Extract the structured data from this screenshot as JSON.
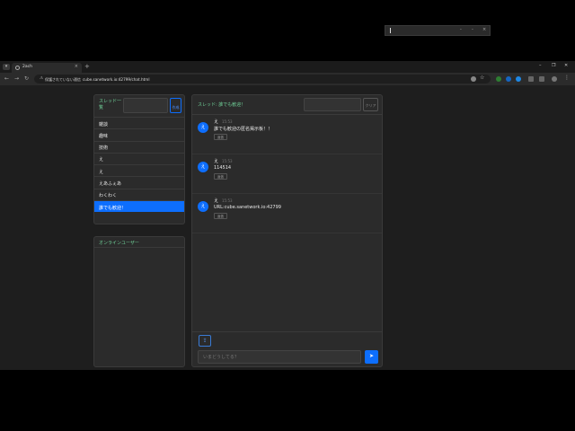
{
  "browser": {
    "tab_title": "2ach",
    "tab_close": "×",
    "new_tab": "+",
    "menu": "▾",
    "win_min": "–",
    "win_max": "❐",
    "win_close": "✕",
    "back": "←",
    "forward": "→",
    "reload": "↻",
    "security_label": "保護されていない通信",
    "url": "cube.sanetwork.io:42799/chat.html"
  },
  "popup": {
    "ctl1": "-",
    "ctl2": "-",
    "ctl3": "×"
  },
  "threads": {
    "title": "スレッド一覧",
    "new_thread_button": "作成",
    "items": [
      {
        "label": "雑談"
      },
      {
        "label": "趣味"
      },
      {
        "label": "技術"
      },
      {
        "label": "え"
      },
      {
        "label": "え"
      },
      {
        "label": "えあふぇあ"
      },
      {
        "label": "わくわく"
      },
      {
        "label": "誰でも歓迎！"
      }
    ],
    "active_index": 7
  },
  "online": {
    "title": "オンラインユーザー"
  },
  "chat": {
    "header_title": "スレッド: 誰でも歓迎！",
    "clear_button": "クリア",
    "messages": [
      {
        "avatar": "え",
        "name": "え",
        "time": "15:53",
        "text": "誰でも歓迎の匿名掲示板！！",
        "reply": "返信"
      },
      {
        "avatar": "え",
        "name": "え",
        "time": "15:53",
        "text": "114514",
        "reply": "返信"
      },
      {
        "avatar": "え",
        "name": "え",
        "time": "15:53",
        "text": "URL:cube.sanetwork.io:42799",
        "reply": "返信"
      }
    ],
    "upload_icon": "⇪",
    "input_placeholder": "いまどうしてる？",
    "send_icon": "➤"
  },
  "colors": {
    "accent": "#0d6efd",
    "green": "#6fcf97",
    "panel": "#2b2b2b",
    "bg": "#1e1e1e"
  }
}
